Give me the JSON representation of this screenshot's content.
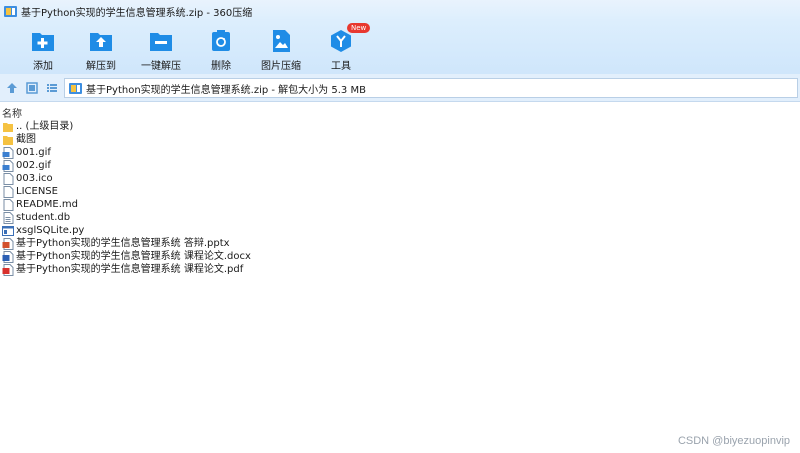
{
  "window": {
    "title": "基于Python实现的学生信息管理系统.zip - 360压缩"
  },
  "toolbar": {
    "items": [
      {
        "label": "添加",
        "icon": "add-icon"
      },
      {
        "label": "解压到",
        "icon": "extract-to-icon"
      },
      {
        "label": "一键解压",
        "icon": "one-click-extract-icon"
      },
      {
        "label": "删除",
        "icon": "delete-icon"
      },
      {
        "label": "图片压缩",
        "icon": "image-compress-icon"
      },
      {
        "label": "工具",
        "icon": "tools-icon",
        "badge": "New"
      }
    ]
  },
  "address": {
    "path_text": "基于Python实现的学生信息管理系统.zip - 解包大小为 5.3 MB"
  },
  "list": {
    "column_name": "名称",
    "files": [
      {
        "name": ".. (上级目录)",
        "icon": "folder-up-icon"
      },
      {
        "name": "截图",
        "icon": "folder-icon"
      },
      {
        "name": "001.gif",
        "icon": "gif-file-icon"
      },
      {
        "name": "002.gif",
        "icon": "gif-file-icon"
      },
      {
        "name": "003.ico",
        "icon": "generic-file-icon"
      },
      {
        "name": "LICENSE",
        "icon": "generic-file-icon"
      },
      {
        "name": "README.md",
        "icon": "generic-file-icon"
      },
      {
        "name": "student.db",
        "icon": "db-file-icon"
      },
      {
        "name": "xsglSQLite.py",
        "icon": "python-file-icon"
      },
      {
        "name": "基于Python实现的学生信息管理系统 答辩.pptx",
        "icon": "pptx-file-icon"
      },
      {
        "name": "基于Python实现的学生信息管理系统 课程论文.docx",
        "icon": "docx-file-icon"
      },
      {
        "name": "基于Python实现的学生信息管理系统 课程论文.pdf",
        "icon": "pdf-file-icon"
      }
    ]
  },
  "watermark": "CSDN @biyezuopinvip",
  "colors": {
    "accent": "#1f8ce6",
    "folder": "#f5c242",
    "badge": "#e8382f"
  }
}
